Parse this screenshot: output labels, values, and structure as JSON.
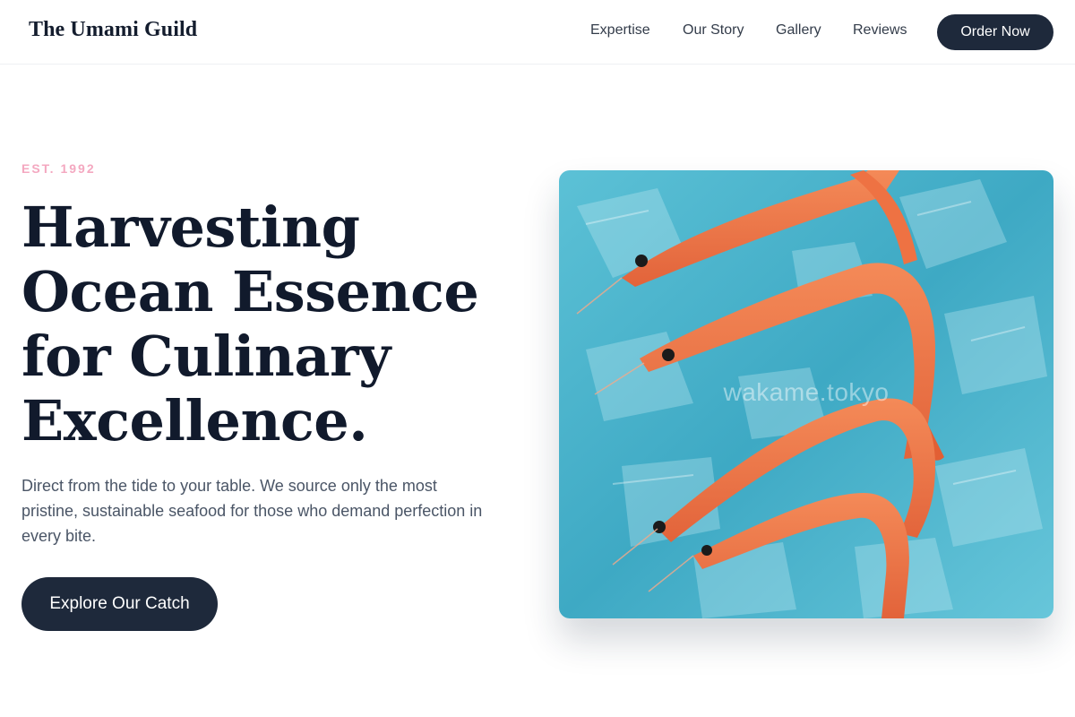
{
  "header": {
    "brand": "The Umami Guild",
    "nav": [
      "Expertise",
      "Our Story",
      "Gallery",
      "Reviews"
    ],
    "order_label": "Order Now"
  },
  "hero": {
    "eyebrow": "EST. 1992",
    "headline_lines": [
      "Harvesting",
      "Ocean Essence",
      "for Culinary",
      "Excellence."
    ],
    "lede": "Direct from the tide to your table. We source only the most pristine, sustainable seafood for those who demand perfection in every bite.",
    "cta_label": "Explore Our Catch",
    "image": {
      "subject": "shrimp-on-ice",
      "watermark": "wakame.tokyo",
      "colors": {
        "ice": "#4fb3cc",
        "shrimp": "#f07a4a"
      }
    }
  }
}
